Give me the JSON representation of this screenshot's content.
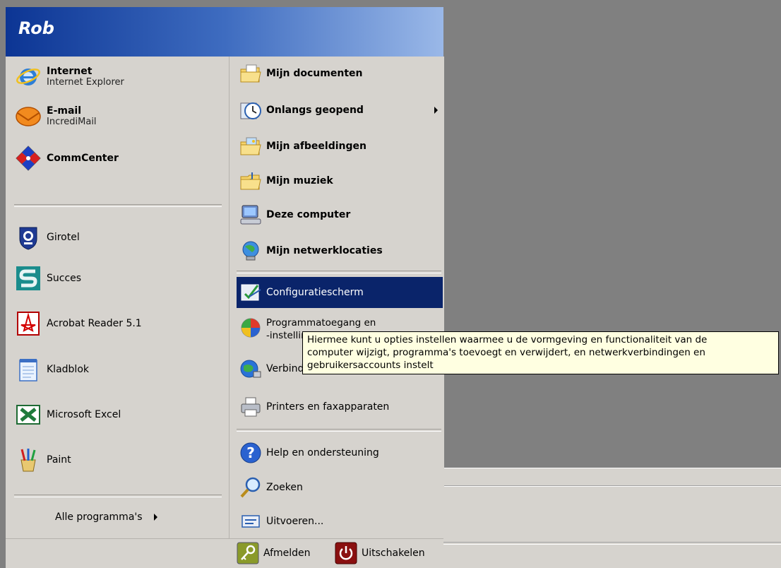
{
  "user": {
    "name": "Rob"
  },
  "pinned": [
    {
      "title": "Internet",
      "subtitle": "Internet Explorer"
    },
    {
      "title": "E-mail",
      "subtitle": "IncrediMail"
    },
    {
      "title": "CommCenter"
    }
  ],
  "recent": [
    "Girotel",
    "Succes",
    "Acrobat Reader 5.1",
    "Kladblok",
    "Microsoft Excel",
    "Paint"
  ],
  "all_programs": "Alle programma's",
  "places": [
    "Mijn documenten",
    "Onlangs geopend",
    "Mijn afbeeldingen",
    "Mijn muziek",
    "Deze computer",
    "Mijn netwerklocaties"
  ],
  "control": {
    "configuratiescherm": "Configuratiescherm",
    "programmatoegang_1": "Programmatoegang en",
    "programmatoegang_2": "-instellingen",
    "verbinding": "Verbinding maken met",
    "printers": "Printers en faxapparaten"
  },
  "help": "Help en ondersteuning",
  "search": "Zoeken",
  "run": "Uitvoeren...",
  "footer": {
    "logoff": "Afmelden",
    "shutdown": "Uitschakelen"
  },
  "tooltip": {
    "line1": "Hiermee kunt u opties instellen waarmee u de vormgeving en functionaliteit van de",
    "line2": "computer wijzigt, programma's toevoegt en verwijdert, en netwerkverbindingen en",
    "line3": "gebruikersaccounts instelt"
  },
  "colors": {
    "header_start": "#0c3594",
    "header_end": "#9ab8e8",
    "menu_bg": "#d6d3ce",
    "highlight": "#0a246a",
    "tooltip_bg": "#ffffe1",
    "desktop": "#808080"
  }
}
